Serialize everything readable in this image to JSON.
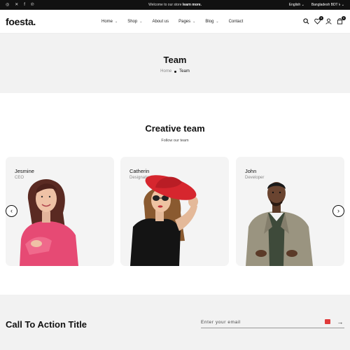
{
  "topbar": {
    "socials": [
      "instagram-icon",
      "x-icon",
      "facebook-icon",
      "pinterest-icon"
    ],
    "announce_prefix": "Welcome to our store",
    "announce_link": "learn more.",
    "language": "English",
    "currency": "Bangladesh BDT ৳"
  },
  "header": {
    "logo": "foesta.",
    "nav": [
      {
        "label": "Home",
        "has_dropdown": true
      },
      {
        "label": "Shop",
        "has_dropdown": true
      },
      {
        "label": "About us",
        "has_dropdown": false
      },
      {
        "label": "Pages",
        "has_dropdown": true
      },
      {
        "label": "Blog",
        "has_dropdown": true
      },
      {
        "label": "Contact",
        "has_dropdown": false
      }
    ],
    "wishlist_count": "0",
    "cart_count": "0"
  },
  "hero": {
    "title": "Team",
    "breadcrumb_home": "Home",
    "breadcrumb_current": "Team"
  },
  "team": {
    "title": "Creative team",
    "subtitle": "Follow our team",
    "members": [
      {
        "name": "Jesmine",
        "role": "CEO"
      },
      {
        "name": "Catherin",
        "role": "Designation"
      },
      {
        "name": "John",
        "role": "Developer"
      }
    ]
  },
  "cta": {
    "title": "Call To Action Title",
    "email_placeholder": "Enter your email"
  },
  "colors": {
    "topbar_bg": "#111111",
    "band_bg": "#f2f2f2",
    "card_bg": "#f4f4f4",
    "accent_red": "#e03a3a"
  }
}
